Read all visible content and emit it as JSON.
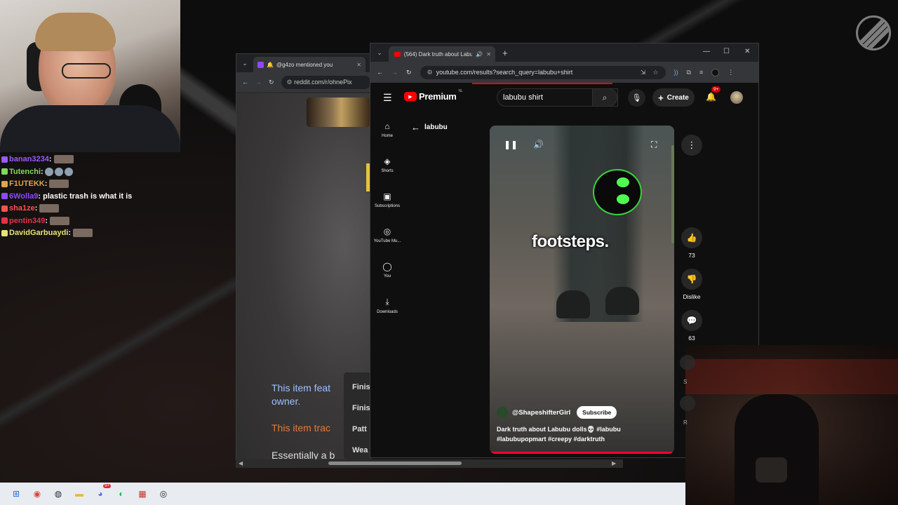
{
  "chat": {
    "messages": [
      {
        "user": "banan3234",
        "sep": ":",
        "text": "",
        "color": "#9b59ff",
        "emotes": 1
      },
      {
        "user": "Tutenchi",
        "sep": ":",
        "text": "",
        "color": "#7ddc5a",
        "emotes": 3
      },
      {
        "user": "F1UTEKK",
        "sep": ":",
        "text": "",
        "color": "#e2a24a",
        "emotes": 1
      },
      {
        "user": "6Wolla9",
        "sep": ":",
        "text": "plastic trash is what it is",
        "color": "#8a4bff",
        "emotes": 0
      },
      {
        "user": "sha1ze",
        "sep": ":",
        "text": "",
        "color": "#ff5050",
        "emotes": 1
      },
      {
        "user": "pentin349",
        "sep": ":",
        "text": "",
        "color": "#e0334a",
        "emotes": 1
      },
      {
        "user": "DavidGarbuaydi",
        "sep": ":",
        "text": "",
        "color": "#e8e27a",
        "emotes": 1
      }
    ]
  },
  "reddit_window": {
    "tab_title": "@g4zo mentioned you",
    "url": "reddit.com/r/ohnePix",
    "text1": "This item feat",
    "text1b": "owner.",
    "text2": "This item trac",
    "text3": "Essentially a b",
    "menu_items": [
      "Finis",
      "Finis",
      "Patt",
      "Wea"
    ],
    "colors": {
      "text2": "#e27a3e",
      "text1": "#9ec0ff"
    }
  },
  "youtube_window": {
    "tab_title": "(564) Dark truth about Labu",
    "url": "youtube.com/results?search_query=labubu+shirt",
    "logo_word": "Premium",
    "logo_sup": "NL",
    "search_value": "labubu shirt",
    "create_label": "Create",
    "notification_count": "9+",
    "back_label": "labubu",
    "sidebar": [
      {
        "icon": "home-icon",
        "glyph": "⌂",
        "label": "Home"
      },
      {
        "icon": "shorts-icon",
        "glyph": "◈",
        "label": "Shorts"
      },
      {
        "icon": "subscriptions-icon",
        "glyph": "▣",
        "label": "Subscriptions"
      },
      {
        "icon": "youtube-music-icon",
        "glyph": "◎",
        "label": "YouTube Mu..."
      },
      {
        "icon": "you-icon",
        "glyph": "◯",
        "label": "You"
      },
      {
        "icon": "downloads-icon",
        "glyph": "⤓",
        "label": "Downloads"
      }
    ],
    "video": {
      "caption": "footsteps.",
      "channel": "@ShapeshifterGirl",
      "subscribe_label": "Subscribe",
      "description": "Dark truth about Labubu dolls💀 #labubu #labubupopmart #creepy #darktruth"
    },
    "actions": {
      "like_count": "73",
      "dislike_label": "Dislike",
      "comments_count": "63"
    },
    "colors": {
      "accent": "#ff0000",
      "background": "#0f0f0f"
    }
  },
  "cam2": {
    "label_s": "S",
    "label_r": "R"
  },
  "taskbar": {
    "icons": [
      {
        "name": "windows-start-icon",
        "glyph": "⊞",
        "color": "#1a73e8"
      },
      {
        "name": "chrome-icon",
        "glyph": "◉",
        "color": "#db4437"
      },
      {
        "name": "steam-icon",
        "glyph": "◍",
        "color": "#1b2838"
      },
      {
        "name": "file-explorer-icon",
        "glyph": "▬",
        "color": "#f2b632"
      },
      {
        "name": "discord-icon",
        "glyph": "◕",
        "color": "#5865f2",
        "badge": "9+"
      },
      {
        "name": "spotify-icon",
        "glyph": "◐",
        "color": "#1db954"
      },
      {
        "name": "app-tile-icon",
        "glyph": "▦",
        "color": "#c0392b"
      },
      {
        "name": "obs-icon",
        "glyph": "◎",
        "color": "#222222"
      }
    ]
  }
}
